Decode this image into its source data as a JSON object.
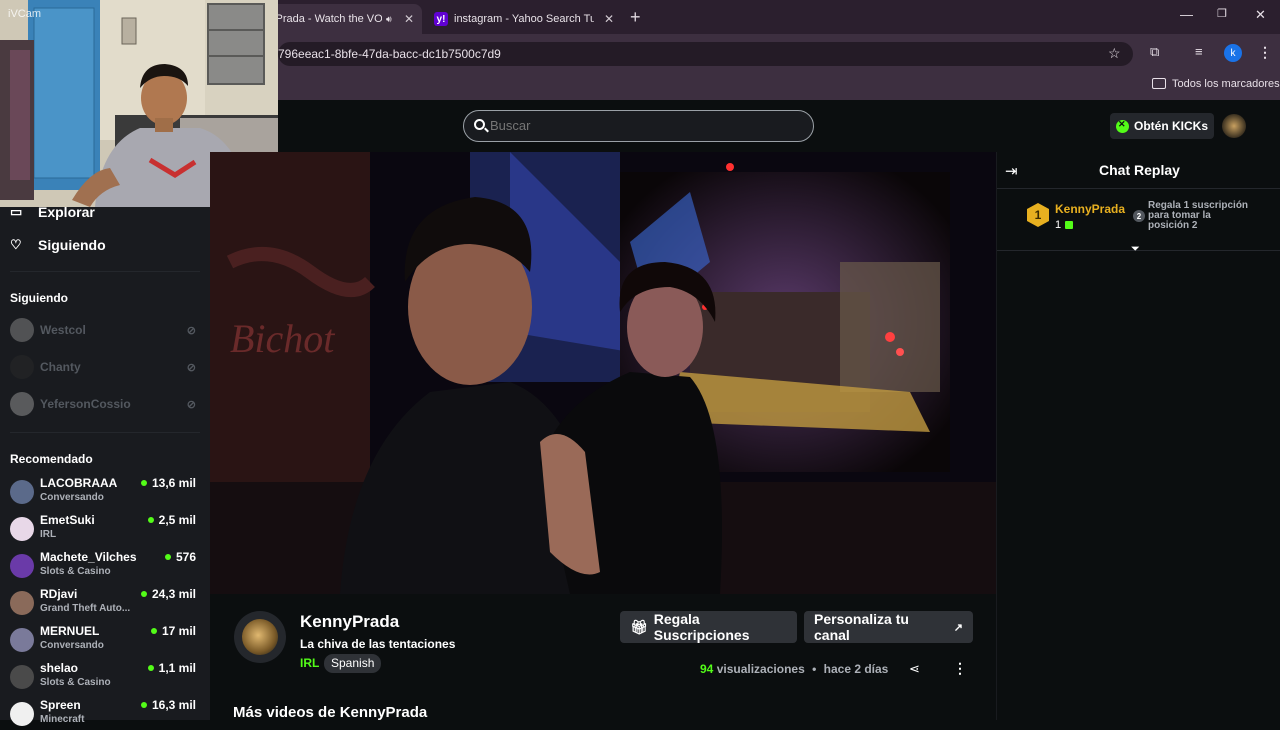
{
  "browser": {
    "tabs": [
      {
        "label": "yPrada - Watch the VO"
      },
      {
        "label": "instagram - Yahoo Search Tus r"
      }
    ],
    "url": "796eeac1-8bfe-47da-bacc-dc1b7500c7d9",
    "bookmarks_label": "Todos los marcadores",
    "profile_initial": "k"
  },
  "webcam": {
    "label": "iVCam"
  },
  "header": {
    "search_placeholder": "Buscar",
    "kicks_button": "Obtén KICKs"
  },
  "sidebar": {
    "nav": [
      {
        "label": "Explorar",
        "icon": "explore-icon"
      },
      {
        "label": "Siguiendo",
        "icon": "heart-icon"
      }
    ],
    "following_title": "Siguiendo",
    "following": [
      {
        "name": "Westcol"
      },
      {
        "name": "Chanty"
      },
      {
        "name": "YefersonCossio"
      }
    ],
    "recommended_title": "Recomendado",
    "recommended": [
      {
        "name": "LACOBRAAA",
        "category": "Conversando",
        "viewers": "13,6 mil",
        "color": "#5b6a8a"
      },
      {
        "name": "EmetSuki",
        "category": "IRL",
        "viewers": "2,5 mil",
        "color": "#e8d8e8"
      },
      {
        "name": "Machete_Vilches",
        "category": "Slots & Casino",
        "viewers": "576",
        "color": "#6a3aa8"
      },
      {
        "name": "RDjavi",
        "category": "Grand Theft Auto...",
        "viewers": "24,3 mil",
        "color": "#8a6a5a"
      },
      {
        "name": "MERNUEL",
        "category": "Conversando",
        "viewers": "17 mil",
        "color": "#7a7a9a"
      },
      {
        "name": "shelao",
        "category": "Slots & Casino",
        "viewers": "1,1 mil",
        "color": "#4a4a4a"
      },
      {
        "name": "Spreen",
        "category": "Minecraft",
        "viewers": "16,3 mil",
        "color": "#f0f0f0"
      }
    ]
  },
  "video": {
    "channel": "KennyPrada",
    "title": "La chiva de las tentaciones",
    "category": "IRL",
    "language": "Spanish",
    "gift_button": "Regala Suscripciones",
    "customize_button": "Personaliza tu canal",
    "views_count": "94",
    "views_label": "visualizaciones",
    "separator": "•",
    "time_ago": "hace 2 días",
    "more_videos": "Más videos de KennyPrada"
  },
  "chat": {
    "title": "Chat Replay",
    "top_gifter": {
      "rank": "1",
      "name": "KennyPrada",
      "count": "1"
    },
    "position_rank": "2",
    "position_text": "Regala 1 suscripción para tomar la posición 2"
  },
  "colors": {
    "accent": "#53fc18",
    "gold": "#e8b020",
    "sidebar_bg": "#191b1f",
    "page_bg": "#0b0e0f"
  }
}
